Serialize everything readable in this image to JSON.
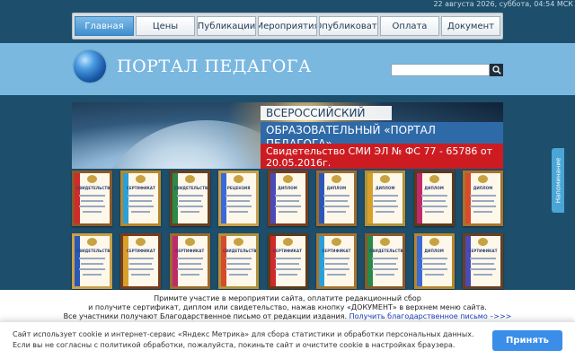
{
  "header": {
    "datetime": "22 августа 2026, суббота, 04:54 МСК",
    "site_title": "ПОРТАЛ ПЕДАГОГА",
    "search_icon": "search-icon",
    "logo_icon": "globe-icon"
  },
  "nav": {
    "items": [
      {
        "label": "Главная",
        "active": true
      },
      {
        "label": "Цены"
      },
      {
        "label": "Публикации"
      },
      {
        "label": "Мероприятия"
      },
      {
        "label": "Опубликовать"
      },
      {
        "label": "Оплата"
      },
      {
        "label": "Документ"
      }
    ]
  },
  "hero": {
    "line1": "ВСЕРОССИЙСКИЙ",
    "line2": "ОБРАЗОВАТЕЛЬНЫЙ «ПОРТАЛ ПЕДАГОГА»",
    "line3": "Свидетельство СМИ ЭЛ № ФС 77 - 65786 от 20.05.2016г."
  },
  "certificates": {
    "row1": [
      "СВИДЕТЕЛЬСТВО",
      "СЕРТИФИКАТ",
      "СВИДЕТЕЛЬСТВО",
      "РЕЦЕНЗИЯ",
      "ДИПЛОМ",
      "ДИПЛОМ",
      "ДИПЛОМ",
      "ДИПЛОМ",
      "ДИПЛОМ"
    ],
    "row2": [
      "СВИДЕТЕЛЬСТВО",
      "СЕРТИФИКАТ",
      "СЕРТИФИКАТ",
      "СВИДЕТЕЛЬСТВО",
      "СЕРТИФИКАТ",
      "СЕРТИФИКАТ",
      "СВИДЕТЕЛЬСТВО",
      "ДИПЛОМ",
      "СЕРТИФИКАТ"
    ]
  },
  "side_tab": {
    "label": "Напоминание"
  },
  "info": {
    "line1": "Примите участие в мероприятии сайта, оплатите редакционный сбор",
    "line2": "и получите сертификат, диплом или свидетельство, нажав кнопку «ДОКУМЕНТ» в верхнем меню сайта.",
    "line3": "Все участники получают Благодарственное письмо от редакции издания.",
    "link": "Получить благодарственное письмо –>>>"
  },
  "cookie": {
    "text": "Сайт использует cookie и интернет-сервис «Яндекс Метрика» для сбора статистики и обработки персональных данных. Если вы не согласны с политикой обработки, пожалуйста, покиньте сайт и очистите cookie в настройках браузера.",
    "accept_label": "Принять"
  },
  "colors": {
    "dark_bg": "#1d4f6c",
    "band": "#7ab8e0",
    "nav_active": "#3d8fcf",
    "hero_blue": "#2f6aa8",
    "hero_red": "#cc1c22",
    "button": "#3b8ee8"
  }
}
